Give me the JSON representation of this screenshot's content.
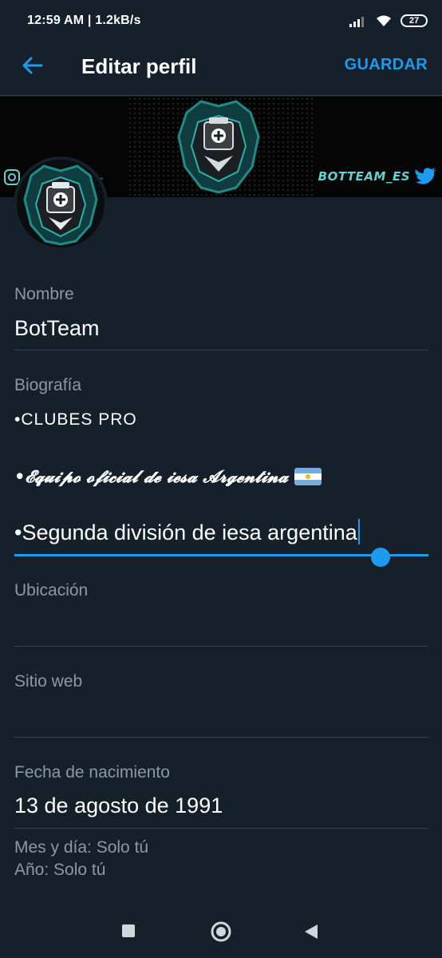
{
  "status_bar": {
    "time": "12:59 AM | 1.2kB/s",
    "battery": "27"
  },
  "header": {
    "title": "Editar perfil",
    "save_label": "GUARDAR"
  },
  "banner": {
    "handle_right": "BOTTEAM_ES",
    "handle_left": "ES"
  },
  "form": {
    "name_label": "Nombre",
    "name_value": "BotTeam",
    "bio_label": "Biografía",
    "bio_lines": [
      "•CLUBES PRO",
      "•𝓔𝓺𝓾𝓲𝓹𝓸 𝓸𝓯𝓲𝓬𝓲𝓪𝓵 𝓭𝓮 𝓲𝓮𝓼𝓪 𝓐𝓻𝓰𝓮𝓷𝓽𝓲𝓷𝓪",
      "•Segunda división de iesa argentina"
    ],
    "location_label": "Ubicación",
    "website_label": "Sitio web",
    "birth_label": "Fecha de nacimiento",
    "birth_value": "13 de agosto de 1991",
    "privacy_day": "Mes y día: Solo tú",
    "privacy_year": "Año: Solo tú"
  },
  "colors": {
    "background": "#15202b",
    "accent": "#1d9bf0",
    "muted": "#8b98a5",
    "divider": "#38444d"
  },
  "icons": {
    "back": "arrow-left-icon",
    "nav": [
      "square-icon",
      "circle-icon",
      "triangle-back-icon"
    ]
  }
}
